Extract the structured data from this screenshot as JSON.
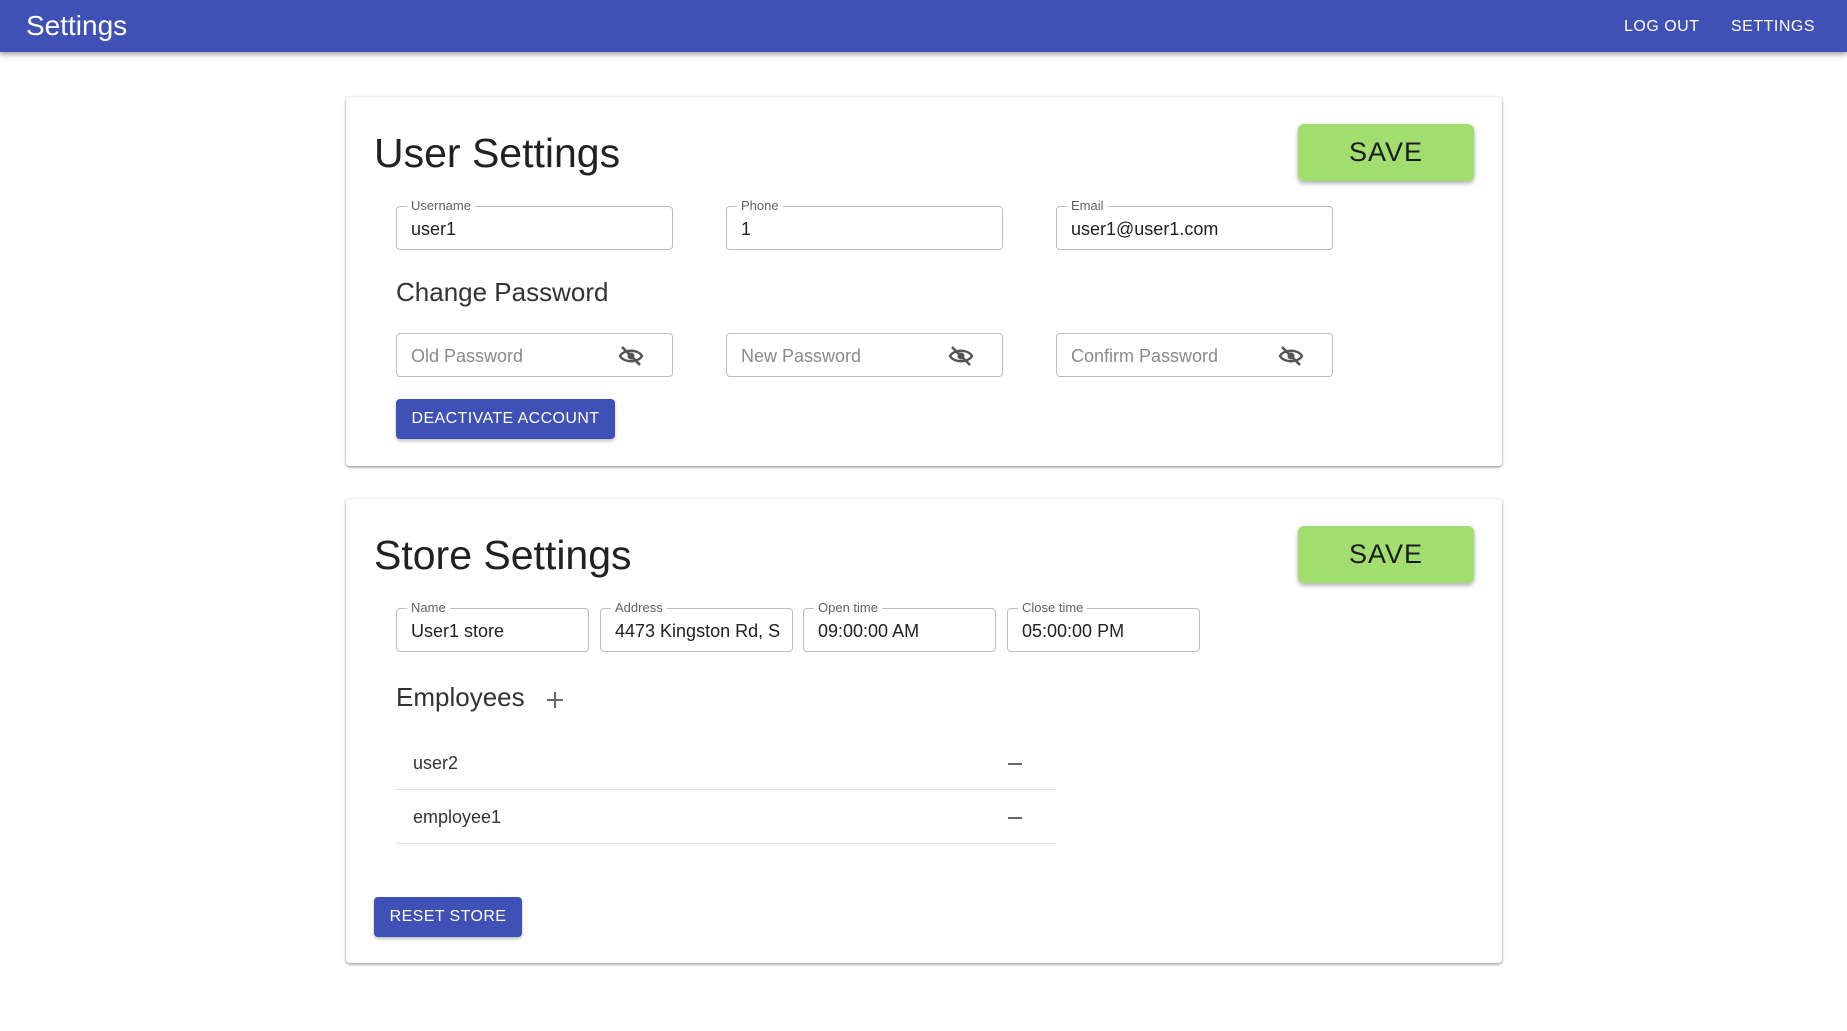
{
  "appbar": {
    "title": "Settings",
    "nav": {
      "logout": "LOG OUT",
      "settings": "SETTINGS"
    }
  },
  "user_settings": {
    "title": "User Settings",
    "save_label": "SAVE",
    "fields": {
      "username": {
        "label": "Username",
        "value": "user1"
      },
      "phone": {
        "label": "Phone",
        "value": "1"
      },
      "email": {
        "label": "Email",
        "value": "user1@user1.com"
      }
    },
    "change_password": {
      "heading": "Change Password",
      "old_placeholder": "Old Password",
      "new_placeholder": "New Password",
      "confirm_placeholder": "Confirm Password"
    },
    "deactivate_label": "DEACTIVATE ACCOUNT"
  },
  "store_settings": {
    "title": "Store Settings",
    "save_label": "SAVE",
    "fields": {
      "name": {
        "label": "Name",
        "value": "User1 store"
      },
      "address": {
        "label": "Address",
        "value": "4473 Kingston Rd, S"
      },
      "open_time": {
        "label": "Open time",
        "value": "09:00:00 AM"
      },
      "close_time": {
        "label": "Close time",
        "value": "05:00:00 PM"
      }
    },
    "employees_heading": "Employees",
    "employees": [
      {
        "name": "user2"
      },
      {
        "name": "employee1"
      }
    ],
    "reset_label": "RESET STORE"
  },
  "icons": {
    "add": "plus-icon",
    "remove": "minus-icon",
    "password_visibility": "eye-off-icon"
  },
  "colors": {
    "primary": "#3f51b5",
    "save": "#a1de6f"
  }
}
